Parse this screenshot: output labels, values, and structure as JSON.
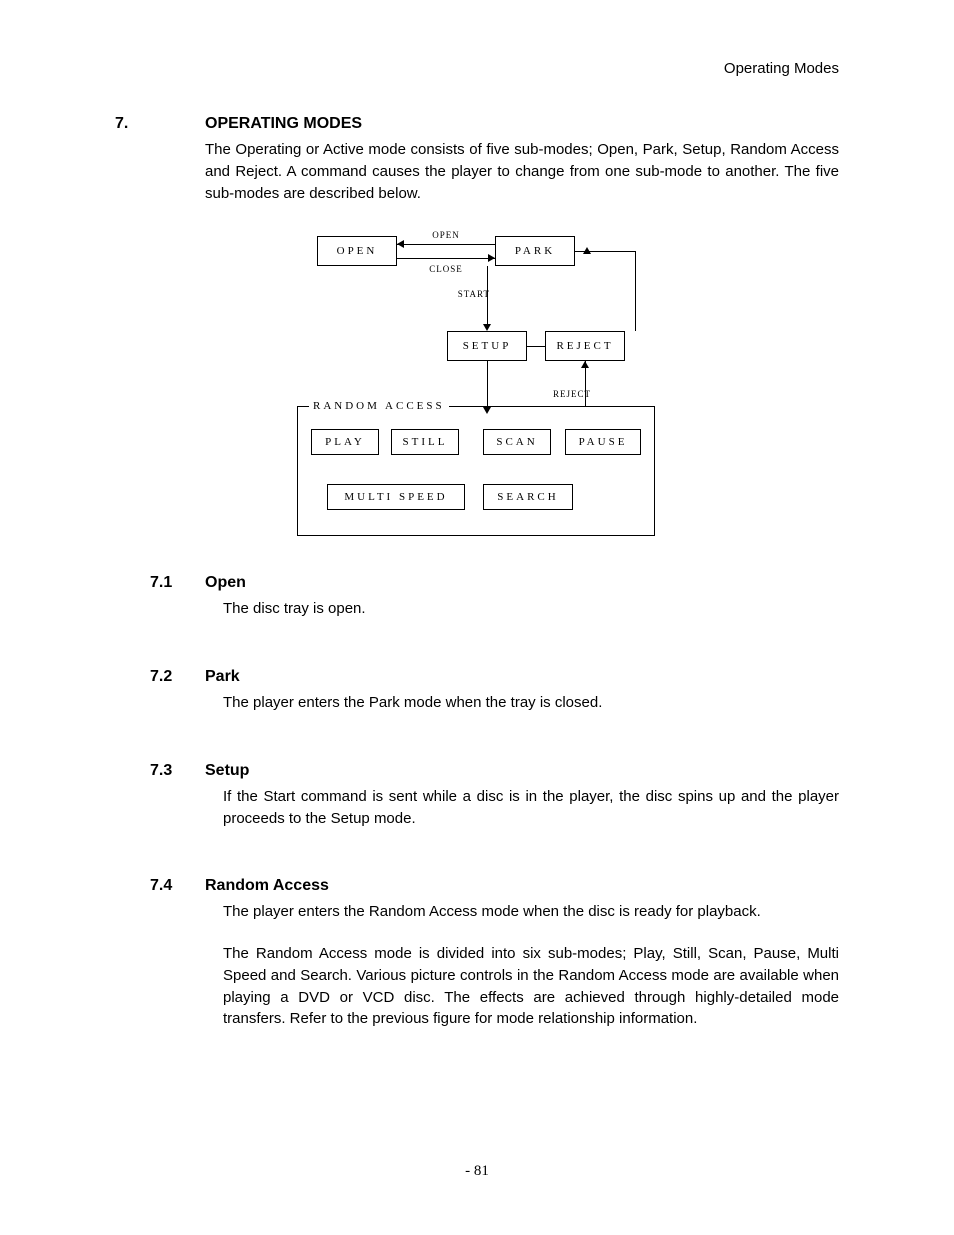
{
  "header": {
    "right": "Operating Modes"
  },
  "s7": {
    "num": "7.",
    "title": "OPERATING MODES",
    "para": "The Operating or Active mode consists of five sub-modes; Open, Park, Setup, Random Access and Reject. A command causes the player to change from one sub-mode to another. The five sub-modes are described below."
  },
  "diagram": {
    "open_label": "OPEN",
    "close_label": "CLOSE",
    "start_label": "START",
    "reject_label": "REJECT",
    "ra_label": "RANDOM ACCESS",
    "boxes": {
      "open": "OPEN",
      "park": "PARK",
      "setup": "SETUP",
      "reject": "REJECT",
      "play": "PLAY",
      "still": "STILL",
      "scan": "SCAN",
      "pause": "PAUSE",
      "multispeed": "MULTI SPEED",
      "search": "SEARCH"
    }
  },
  "s71": {
    "num": "7.1",
    "title": "Open",
    "para": "The disc tray is open."
  },
  "s72": {
    "num": "7.2",
    "title": "Park",
    "para": "The player enters the Park mode when the tray is closed."
  },
  "s73": {
    "num": "7.3",
    "title": "Setup",
    "para": "If the Start command is sent while a disc is in the player, the disc spins up and the player proceeds to the Setup mode."
  },
  "s74": {
    "num": "7.4",
    "title": "Random Access",
    "para1": "The player enters the Random Access mode when the disc is ready for playback.",
    "para2": "The Random Access mode is divided into six sub-modes; Play, Still, Scan, Pause, Multi Speed and Search.  Various picture controls in the Random Access mode are available when playing a DVD or VCD disc.  The effects are achieved through highly-detailed mode transfers.  Refer to the previous figure for mode relationship information."
  },
  "page_number": "- 81"
}
